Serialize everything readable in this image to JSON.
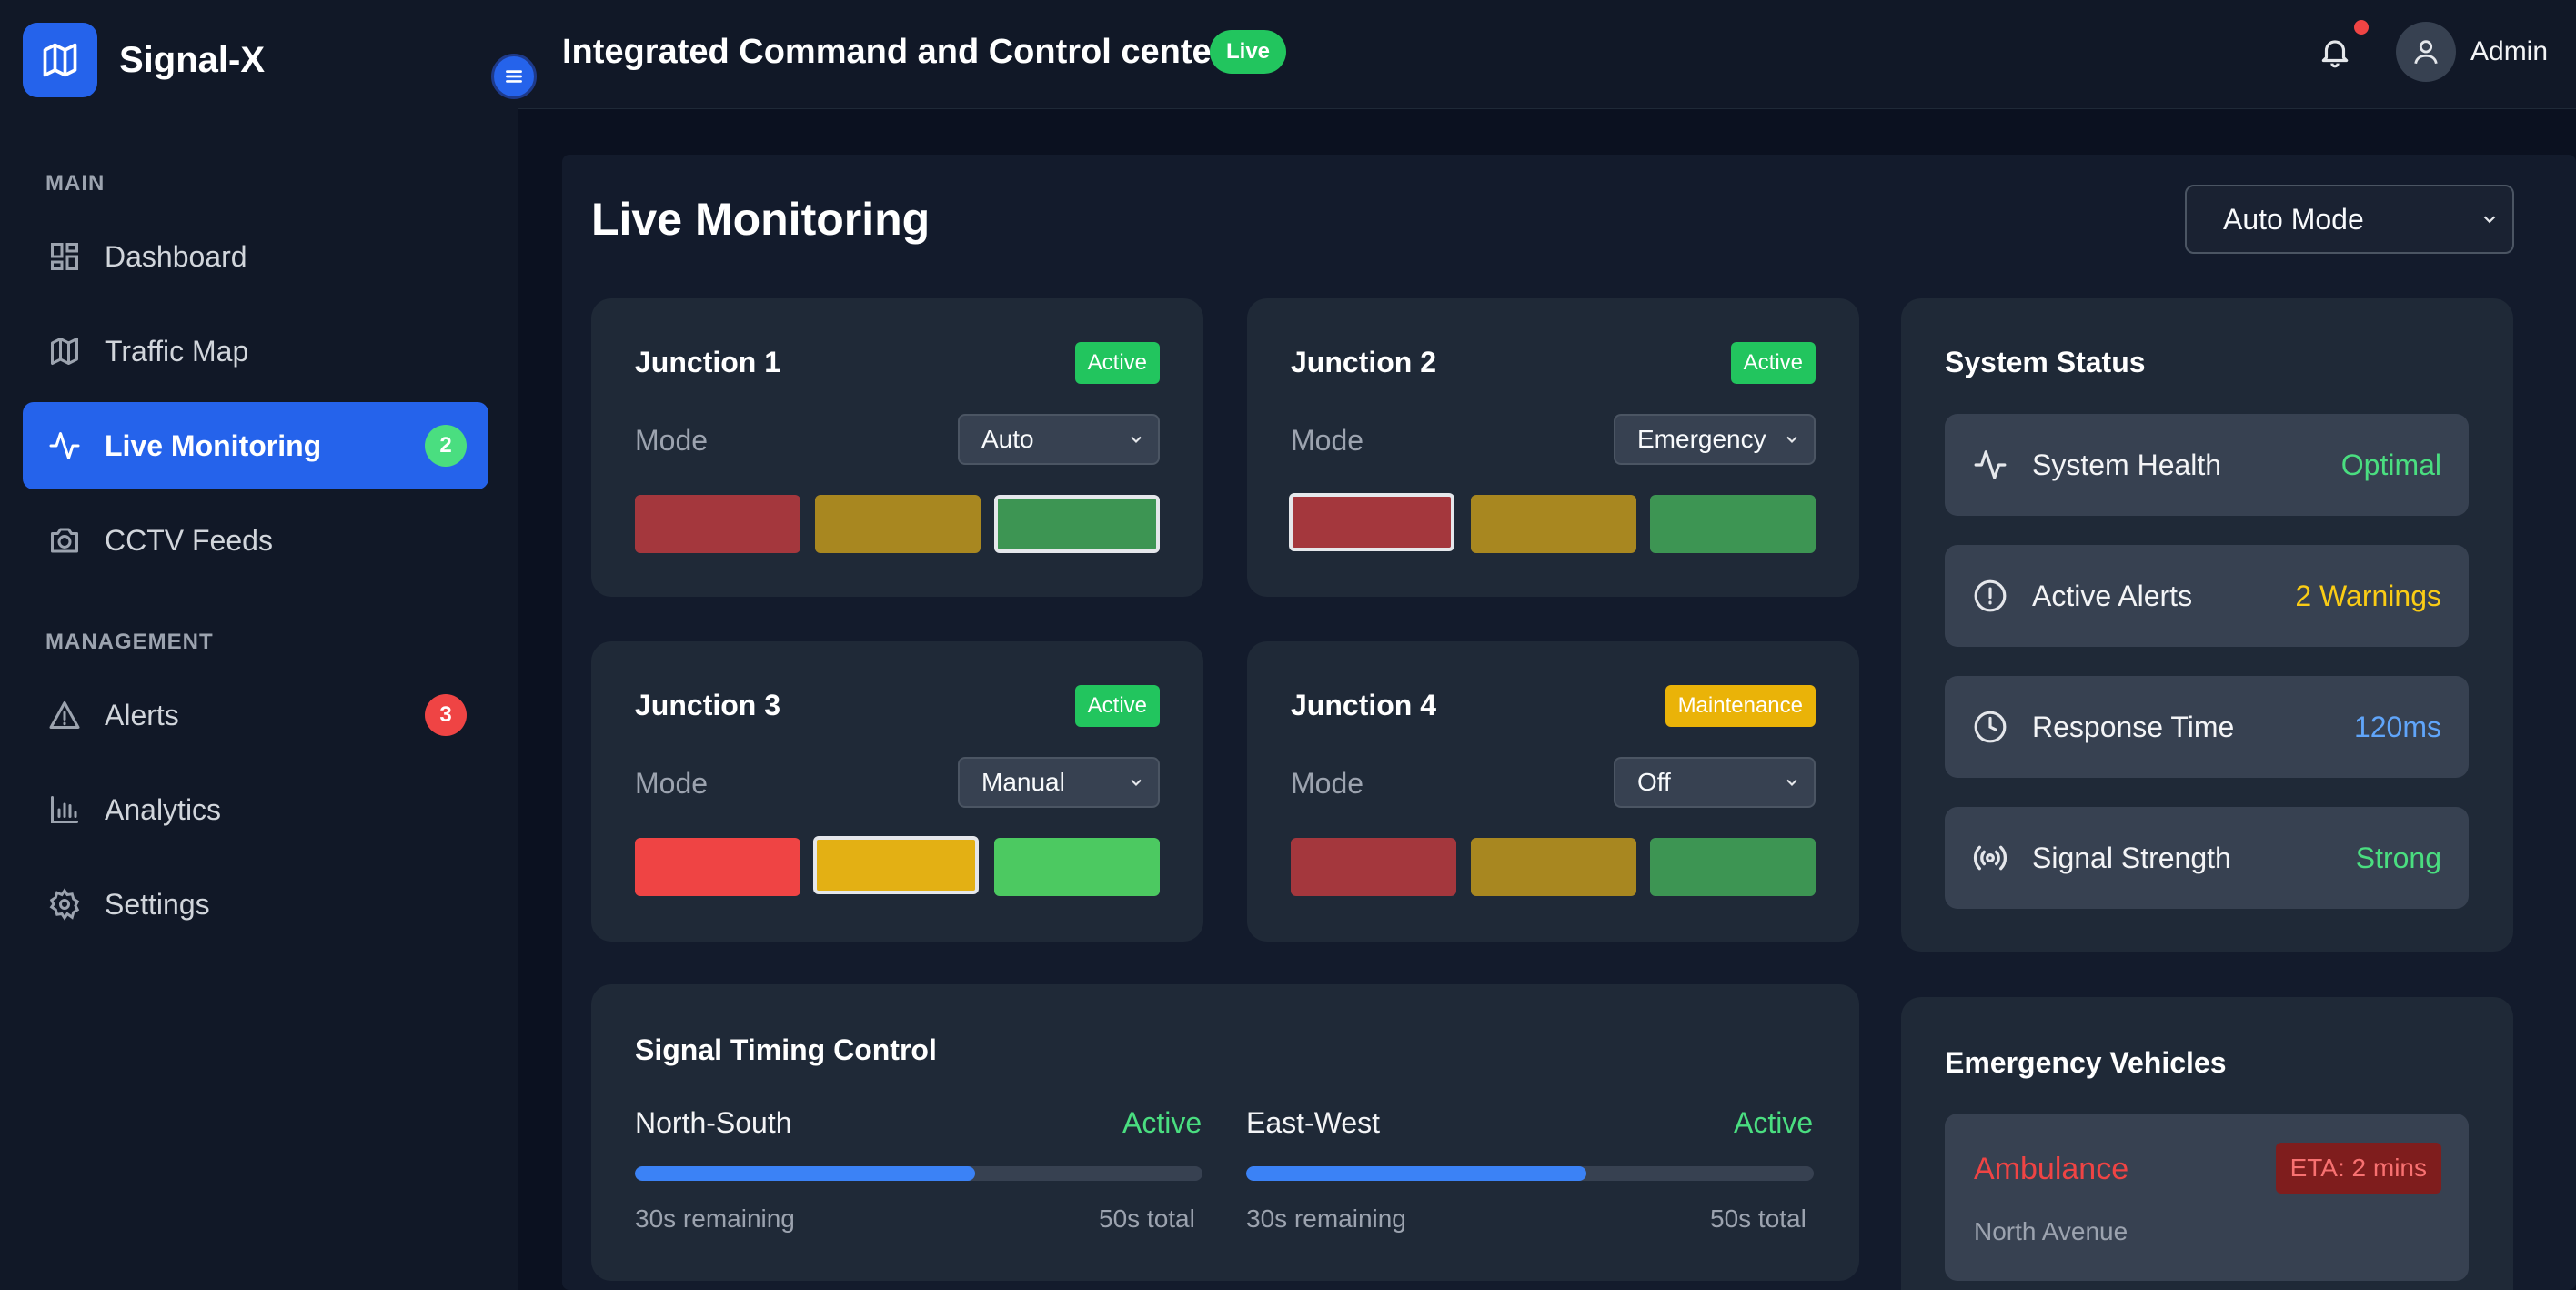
{
  "brand": {
    "name": "Signal-X"
  },
  "sidebar": {
    "sections": [
      "MAIN",
      "MANAGEMENT"
    ],
    "items": [
      {
        "label": "Dashboard",
        "icon": "dashboard-icon"
      },
      {
        "label": "Traffic Map",
        "icon": "map-icon"
      },
      {
        "label": "Live Monitoring",
        "icon": "activity-icon",
        "badge": "2",
        "active": true
      },
      {
        "label": "CCTV Feeds",
        "icon": "camera-icon"
      },
      {
        "label": "Alerts",
        "icon": "alert-triangle-icon",
        "badge": "3"
      },
      {
        "label": "Analytics",
        "icon": "bar-chart-icon"
      },
      {
        "label": "Settings",
        "icon": "gear-icon"
      }
    ]
  },
  "header": {
    "title": "Integrated Command and Control center",
    "live_label": "Live",
    "user": "Admin"
  },
  "main": {
    "title": "Live Monitoring",
    "mode_select": "Auto Mode",
    "junctions": [
      {
        "name": "Junction 1",
        "status": "Active",
        "mode_label": "Mode",
        "mode": "Auto",
        "selected_light": "green"
      },
      {
        "name": "Junction 2",
        "status": "Active",
        "mode_label": "Mode",
        "mode": "Emergency",
        "selected_light": "red"
      },
      {
        "name": "Junction 3",
        "status": "Active",
        "mode_label": "Mode",
        "mode": "Manual",
        "selected_light": "yellow"
      },
      {
        "name": "Junction 4",
        "status": "Maintenance",
        "mode_label": "Mode",
        "mode": "Off",
        "selected_light": "none"
      }
    ],
    "timing": {
      "title": "Signal Timing Control",
      "directions": [
        {
          "name": "North-South",
          "state": "Active",
          "remaining": "30s remaining",
          "total": "50s total",
          "progress": 0.6
        },
        {
          "name": "East-West",
          "state": "Active",
          "remaining": "30s remaining",
          "total": "50s total",
          "progress": 0.6
        }
      ]
    }
  },
  "system_status": {
    "title": "System Status",
    "rows": [
      {
        "label": "System Health",
        "value": "Optimal",
        "color": "#4ade80",
        "icon": "activity-icon"
      },
      {
        "label": "Active Alerts",
        "value": "2 Warnings",
        "color": "#facc15",
        "icon": "alert-circle-icon"
      },
      {
        "label": "Response Time",
        "value": "120ms",
        "color": "#60a5fa",
        "icon": "clock-icon"
      },
      {
        "label": "Signal Strength",
        "value": "Strong",
        "color": "#4ade80",
        "icon": "broadcast-icon"
      }
    ]
  },
  "emergency": {
    "title": "Emergency Vehicles",
    "vehicles": [
      {
        "type": "Ambulance",
        "eta": "ETA: 2 mins",
        "location": "North Avenue"
      }
    ]
  },
  "colors": {
    "accent": "#2563eb",
    "red_dim": "#a4373d",
    "yellow_dim": "#a88720",
    "green_dim": "#3d9553",
    "red": "#ef4444",
    "yellow": "#e3b014",
    "green": "#4cc961"
  }
}
